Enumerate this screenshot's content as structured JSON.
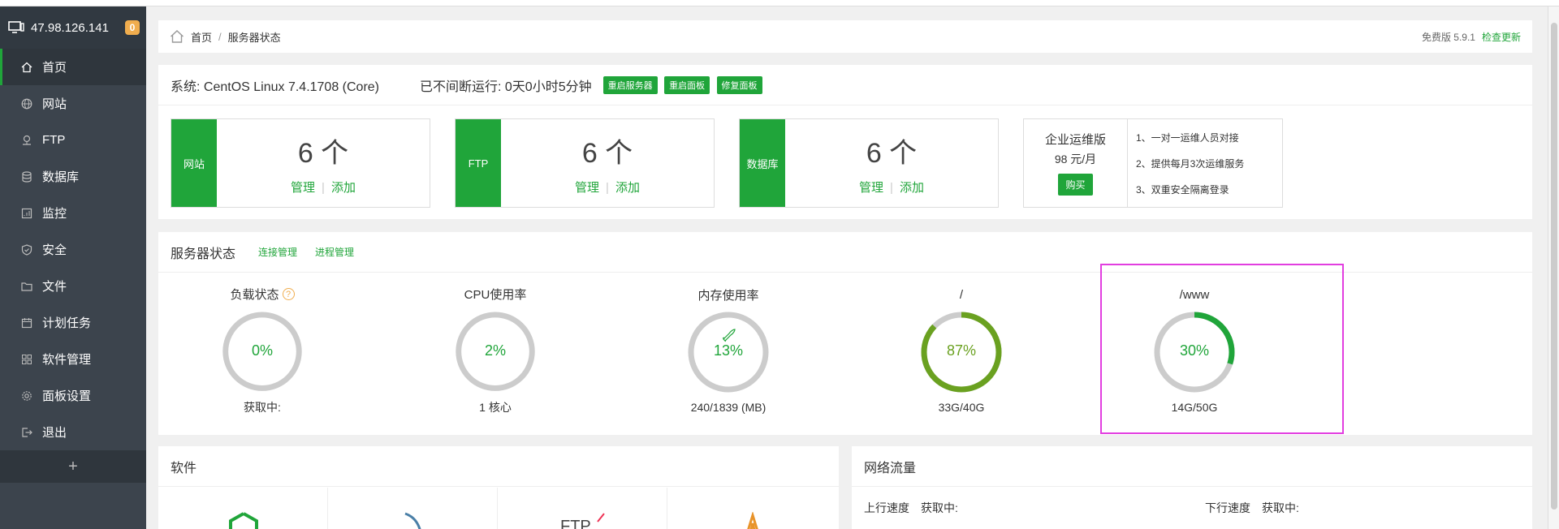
{
  "sidebar": {
    "host_ip": "47.98.126.141",
    "badge_count": "0",
    "items": [
      {
        "label": "首页",
        "icon": "home-icon"
      },
      {
        "label": "网站",
        "icon": "globe-icon"
      },
      {
        "label": "FTP",
        "icon": "ftp-icon"
      },
      {
        "label": "数据库",
        "icon": "database-icon"
      },
      {
        "label": "监控",
        "icon": "monitor-icon"
      },
      {
        "label": "安全",
        "icon": "shield-icon"
      },
      {
        "label": "文件",
        "icon": "folder-icon"
      },
      {
        "label": "计划任务",
        "icon": "calendar-icon"
      },
      {
        "label": "软件管理",
        "icon": "grid-icon"
      },
      {
        "label": "面板设置",
        "icon": "gear-icon"
      },
      {
        "label": "退出",
        "icon": "logout-icon"
      }
    ],
    "add_label": "+"
  },
  "breadcrumb": {
    "home": "首页",
    "sep": "/",
    "current": "服务器状态",
    "version": "免费版 5.9.1",
    "check_update": "检查更新"
  },
  "system": {
    "os": "系统: CentOS Linux 7.4.1708 (Core)",
    "uptime": "已不间断运行: 0天0小时5分钟",
    "buttons": [
      "重启服务器",
      "重启面板",
      "修复面板"
    ]
  },
  "cards": [
    {
      "label": "网站",
      "count": "6 个",
      "manage": "管理",
      "add": "添加"
    },
    {
      "label": "FTP",
      "count": "6 个",
      "manage": "管理",
      "add": "添加"
    },
    {
      "label": "数据库",
      "count": "6 个",
      "manage": "管理",
      "add": "添加"
    }
  ],
  "enterprise": {
    "title": "企业运维版",
    "price": "98 元/月",
    "buy": "购买",
    "features": [
      "1、一对一运维人员对接",
      "2、提供每月3次运维服务",
      "3、双重安全隔离登录"
    ]
  },
  "server_status": {
    "title": "服务器状态",
    "links": [
      "连接管理",
      "进程管理"
    ],
    "gauges": [
      {
        "title": "负载状态",
        "value": "0%",
        "sub": "获取中:",
        "percent": 0,
        "color": "#20a53a"
      },
      {
        "title": "CPU使用率",
        "value": "2%",
        "sub": "1 核心",
        "percent": 0,
        "color": "#20a53a"
      },
      {
        "title": "内存使用率",
        "value": "13%",
        "sub": "240/1839 (MB)",
        "percent": 0,
        "color": "#20a53a"
      },
      {
        "title": "/",
        "value": "87%",
        "sub": "33G/40G",
        "percent": 87,
        "color": "#6aa120"
      },
      {
        "title": "/www",
        "value": "30%",
        "sub": "14G/50G",
        "percent": 30,
        "color": "#20a53a"
      }
    ]
  },
  "software": {
    "title": "软件"
  },
  "network": {
    "title": "网络流量",
    "up_label": "上行速度",
    "up_value": "获取中:",
    "down_label": "下行速度",
    "down_value": "获取中:"
  }
}
